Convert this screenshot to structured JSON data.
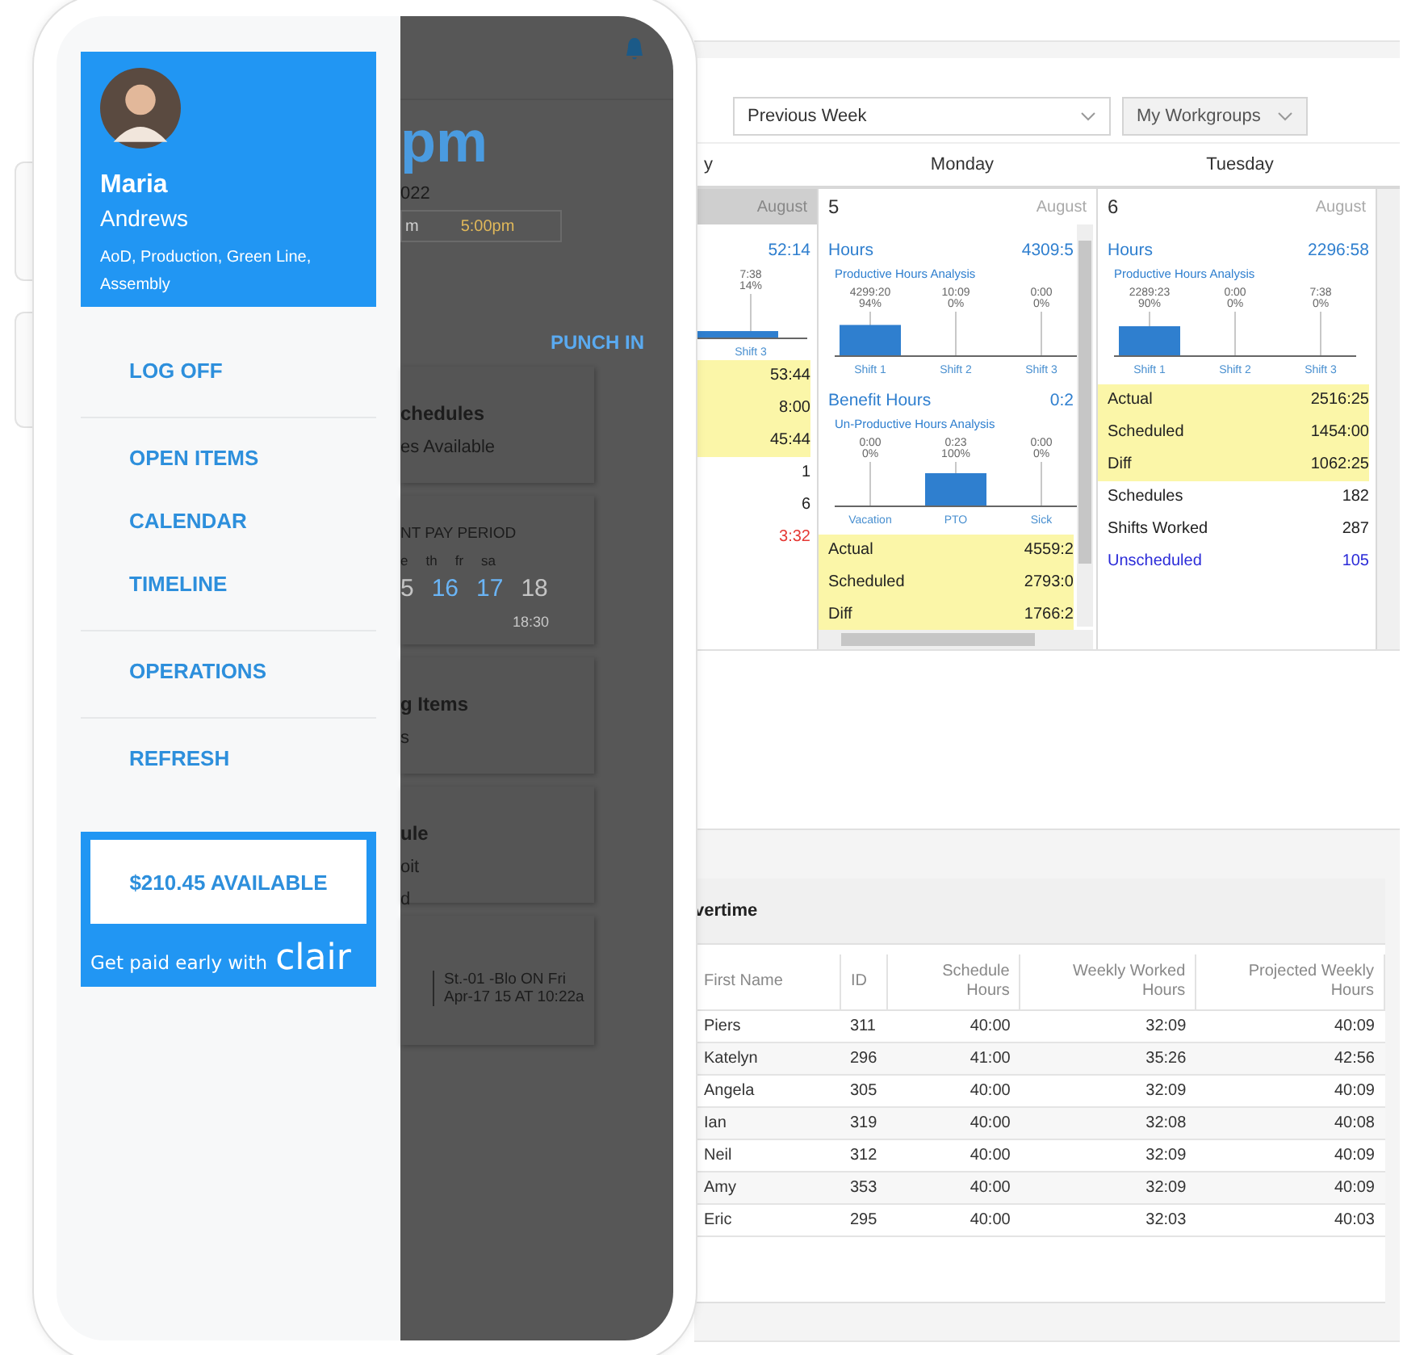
{
  "phone": {
    "menu": {
      "profile": {
        "first_name": "Maria",
        "last_name": "Andrews",
        "assignment": "AoD, Production, Green Line, Assembly"
      },
      "sections": [
        {
          "items": [
            {
              "label": "LOG OFF"
            }
          ]
        },
        {
          "items": [
            {
              "label": "OPEN ITEMS"
            },
            {
              "label": "CALENDAR"
            },
            {
              "label": "TIMELINE"
            }
          ]
        },
        {
          "items": [
            {
              "label": "OPERATIONS"
            }
          ]
        },
        {
          "items": [
            {
              "label": "REFRESH"
            }
          ]
        }
      ],
      "pay_card": {
        "amount": "$210.45 AVAILABLE",
        "tagline": "Get paid early with",
        "brand": "clair"
      }
    },
    "background_screen": {
      "time": "pm",
      "date": "022",
      "shift_start": "m",
      "shift_end": "5:00pm",
      "punch_button": "PUNCH IN",
      "cards": [
        {
          "kind": "summary",
          "title": "chedules",
          "lines": [
            "es Available"
          ]
        },
        {
          "kind": "pay_period",
          "title": "NT PAY PERIOD",
          "weekdays": [
            "e",
            "th",
            "fr",
            "sa"
          ],
          "dates": [
            {
              "day": "5",
              "highlighted": false
            },
            {
              "day": "16",
              "highlighted": true
            },
            {
              "day": "17",
              "highlighted": true
            },
            {
              "day": "18",
              "highlighted": false
            }
          ],
          "note": "18:30"
        },
        {
          "kind": "summary",
          "title": "g Items",
          "lines": [
            "s"
          ]
        },
        {
          "kind": "summary",
          "title": "ule",
          "lines": [
            "oit",
            "d"
          ]
        },
        {
          "kind": "message",
          "lines": [
            "St.-01 -Blo ON Fri",
            "Apr-17 15 AT 10:22a"
          ]
        }
      ]
    }
  },
  "desktop": {
    "filters": [
      {
        "label": "Previous Week"
      },
      {
        "label": "My Workgroups"
      }
    ],
    "day_headers": [
      "y",
      "Monday",
      "Tuesday"
    ],
    "days": [
      {
        "kind": "partial",
        "selected": true,
        "month": "August",
        "hours": {
          "value": "52:14"
        },
        "partial_chart": {
          "hours_label": "7:38",
          "share_label": "14%",
          "category": "Shift 3"
        },
        "totals": [
          {
            "value": "53:44"
          },
          {
            "value": "8:00"
          },
          {
            "value": "45:44"
          }
        ],
        "stats": [
          {
            "value": "1",
            "kind": "plain"
          },
          {
            "value": "6",
            "kind": "plain"
          },
          {
            "value": "3:32",
            "kind": "alert"
          }
        ]
      },
      {
        "kind": "scrolling",
        "selected": false,
        "date": "5",
        "month": "August",
        "hours": {
          "label": "Hours",
          "value": "4309:5"
        },
        "productive": {
          "chart_data": {
            "type": "bar",
            "title": "Productive Hours Analysis",
            "categories": [
              "Shift 1",
              "Shift 2",
              "Shift 3"
            ],
            "values": [
              94,
              0,
              0
            ],
            "value_labels": [
              "94%",
              "0%",
              "0%"
            ],
            "grid": true
          },
          "hours_labels": [
            "4299:20",
            "10:09",
            "0:00"
          ]
        },
        "benefit": {
          "label": "Benefit Hours",
          "value": "0:2"
        },
        "unproductive": {
          "chart_data": {
            "type": "bar",
            "title": "Un-Productive Hours Analysis",
            "categories": [
              "Vacation",
              "PTO",
              "Sick"
            ],
            "values": [
              0,
              100,
              0
            ],
            "value_labels": [
              "0%",
              "100%",
              "0%"
            ],
            "grid": true
          },
          "hours_labels": [
            "0:00",
            "0:23",
            "0:00"
          ]
        },
        "totals": [
          {
            "label": "Actual",
            "value": "4559:2"
          },
          {
            "label": "Scheduled",
            "value": "2793:0"
          },
          {
            "label": "Diff",
            "value": "1766:2"
          }
        ]
      },
      {
        "kind": "full",
        "selected": false,
        "date": "6",
        "month": "August",
        "hours": {
          "label": "Hours",
          "value": "2296:58"
        },
        "productive": {
          "chart_data": {
            "type": "bar",
            "title": "Productive Hours Analysis",
            "categories": [
              "Shift 1",
              "Shift 2",
              "Shift 3"
            ],
            "values": [
              90,
              0,
              0
            ],
            "value_labels": [
              "90%",
              "0%",
              "0%"
            ],
            "grid": true
          },
          "hours_labels": [
            "2289:23",
            "0:00",
            "7:38"
          ]
        },
        "totals": [
          {
            "label": "Actual",
            "value": "2516:25"
          },
          {
            "label": "Scheduled",
            "value": "1454:00"
          },
          {
            "label": "Diff",
            "value": "1062:25"
          }
        ],
        "stats": [
          {
            "label": "Schedules",
            "value": "182",
            "kind": "plain"
          },
          {
            "label": "Shifts Worked",
            "value": "287",
            "kind": "plain"
          },
          {
            "label": "Unscheduled",
            "value": "105",
            "kind": "link"
          }
        ]
      }
    ],
    "overtime": {
      "title": "vertime",
      "columns": [
        "First Name",
        "ID",
        "Schedule Hours",
        "Weekly Worked Hours",
        "Projected Weekly Hours"
      ],
      "rows": [
        [
          "Piers",
          "311",
          "40:00",
          "32:09",
          "40:09"
        ],
        [
          "Katelyn",
          "296",
          "41:00",
          "35:26",
          "42:56"
        ],
        [
          "Angela",
          "305",
          "40:00",
          "32:09",
          "40:09"
        ],
        [
          "Ian",
          "319",
          "40:00",
          "32:08",
          "40:08"
        ],
        [
          "Neil",
          "312",
          "40:00",
          "32:09",
          "40:09"
        ],
        [
          "Amy",
          "353",
          "40:00",
          "32:09",
          "40:09"
        ],
        [
          "Eric",
          "295",
          "40:00",
          "32:03",
          "40:03"
        ]
      ]
    }
  }
}
